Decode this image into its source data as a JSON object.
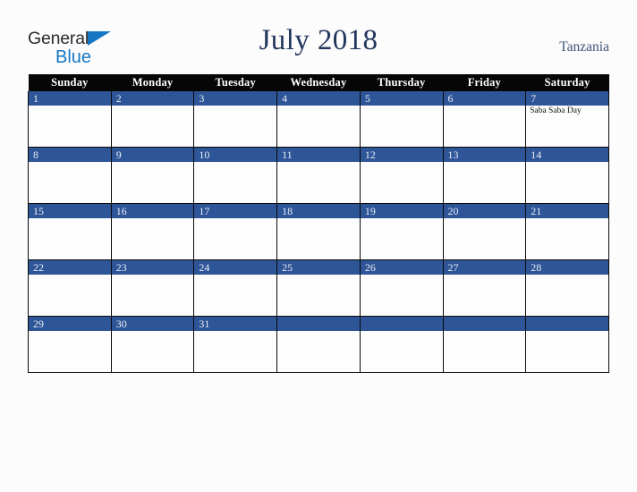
{
  "brand": {
    "name_top": "General",
    "name_bottom": "Blue",
    "triangle_icon": "triangle-icon",
    "color_top": "#2b2b2b",
    "color_bottom": "#1577c4"
  },
  "header": {
    "title": "July 2018",
    "region": "Tanzania",
    "title_color": "#22355c",
    "region_color": "#3f5378"
  },
  "calendar": {
    "month": "July",
    "year": "2018",
    "weekday_headers": [
      "Sunday",
      "Monday",
      "Tuesday",
      "Wednesday",
      "Thursday",
      "Friday",
      "Saturday"
    ],
    "header_bg": "#060606",
    "header_fg": "#ffffff",
    "daybar_bg": "#2e5597",
    "daybar_fg": "#e9eef7",
    "cell_bg": "#fdfdfd",
    "grid_line": "#0a0a0a",
    "weeks": [
      [
        {
          "day": "1",
          "events": []
        },
        {
          "day": "2",
          "events": []
        },
        {
          "day": "3",
          "events": []
        },
        {
          "day": "4",
          "events": []
        },
        {
          "day": "5",
          "events": []
        },
        {
          "day": "6",
          "events": []
        },
        {
          "day": "7",
          "events": [
            "Saba Saba Day"
          ]
        }
      ],
      [
        {
          "day": "8",
          "events": []
        },
        {
          "day": "9",
          "events": []
        },
        {
          "day": "10",
          "events": []
        },
        {
          "day": "11",
          "events": []
        },
        {
          "day": "12",
          "events": []
        },
        {
          "day": "13",
          "events": []
        },
        {
          "day": "14",
          "events": []
        }
      ],
      [
        {
          "day": "15",
          "events": []
        },
        {
          "day": "16",
          "events": []
        },
        {
          "day": "17",
          "events": []
        },
        {
          "day": "18",
          "events": []
        },
        {
          "day": "19",
          "events": []
        },
        {
          "day": "20",
          "events": []
        },
        {
          "day": "21",
          "events": []
        }
      ],
      [
        {
          "day": "22",
          "events": []
        },
        {
          "day": "23",
          "events": []
        },
        {
          "day": "24",
          "events": []
        },
        {
          "day": "25",
          "events": []
        },
        {
          "day": "26",
          "events": []
        },
        {
          "day": "27",
          "events": []
        },
        {
          "day": "28",
          "events": []
        }
      ],
      [
        {
          "day": "29",
          "events": []
        },
        {
          "day": "30",
          "events": []
        },
        {
          "day": "31",
          "events": []
        },
        {
          "day": "",
          "events": []
        },
        {
          "day": "",
          "events": []
        },
        {
          "day": "",
          "events": []
        },
        {
          "day": "",
          "events": []
        }
      ]
    ]
  }
}
